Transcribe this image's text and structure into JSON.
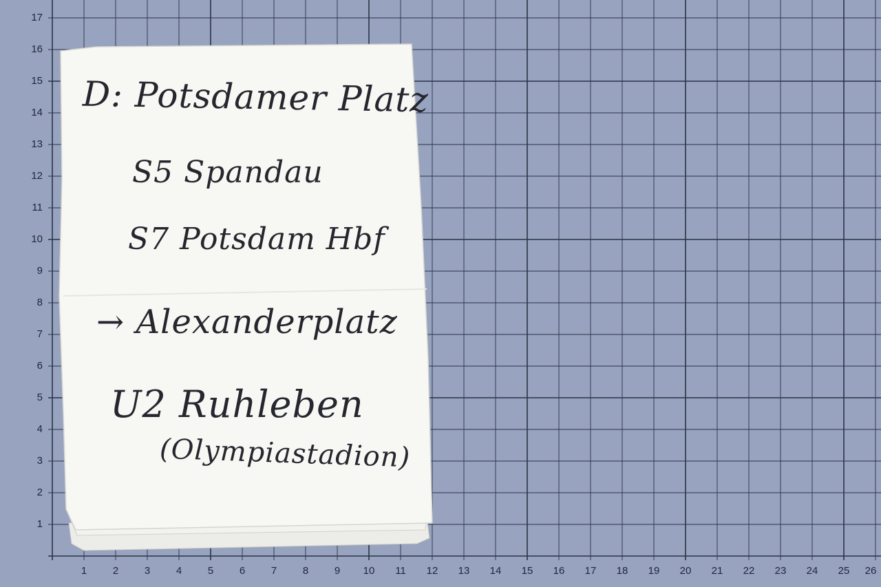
{
  "grid": {
    "y_labels": [
      "1",
      "2",
      "3",
      "4",
      "5",
      "6",
      "7",
      "8",
      "9",
      "10",
      "11",
      "12",
      "13",
      "14",
      "15",
      "16",
      "17"
    ],
    "x_labels": [
      "1",
      "2",
      "3",
      "4",
      "5",
      "6",
      "7",
      "8",
      "9",
      "10",
      "11",
      "12",
      "13",
      "14",
      "15",
      "16",
      "17",
      "18",
      "19",
      "20",
      "21",
      "22",
      "23",
      "24",
      "25",
      "26"
    ],
    "background_color": "#97a3bf",
    "line_color": "#2b3346"
  },
  "note": {
    "paper_color": "#f7f7f4",
    "lines": [
      "D: Potsdamer Platz",
      "S5 Spandau",
      "S7 Potsdam Hbf",
      "→ Alexanderplatz",
      "U2 Ruhleben",
      "(Olympiastadion)"
    ]
  }
}
